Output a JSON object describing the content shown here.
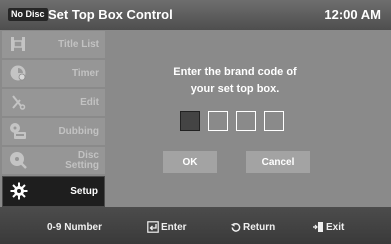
{
  "header": {
    "badge": "No Disc",
    "title": "Set Top Box Control",
    "clock": "12:00 AM"
  },
  "sidebar": {
    "items": [
      {
        "label": "Title List",
        "icon": "film-strip-icon",
        "active": false
      },
      {
        "label": "Timer",
        "icon": "clock-icon",
        "active": false
      },
      {
        "label": "Edit",
        "icon": "scissors-icon",
        "active": false
      },
      {
        "label": "Dubbing",
        "icon": "dubbing-icon",
        "active": false
      },
      {
        "label": "Disc Setting",
        "label_line1": "Disc",
        "label_line2": "Setting",
        "icon": "disc-icon",
        "active": false
      },
      {
        "label": "Setup",
        "icon": "gear-icon",
        "active": true
      }
    ]
  },
  "dialog": {
    "prompt_line1": "Enter the brand code of",
    "prompt_line2": "your set top box.",
    "code_digits": [
      "",
      "",
      "",
      ""
    ],
    "ok_label": "OK",
    "cancel_label": "Cancel"
  },
  "footer": {
    "number_label": "0-9 Number",
    "enter_label": "Enter",
    "return_label": "Return",
    "exit_label": "Exit"
  }
}
